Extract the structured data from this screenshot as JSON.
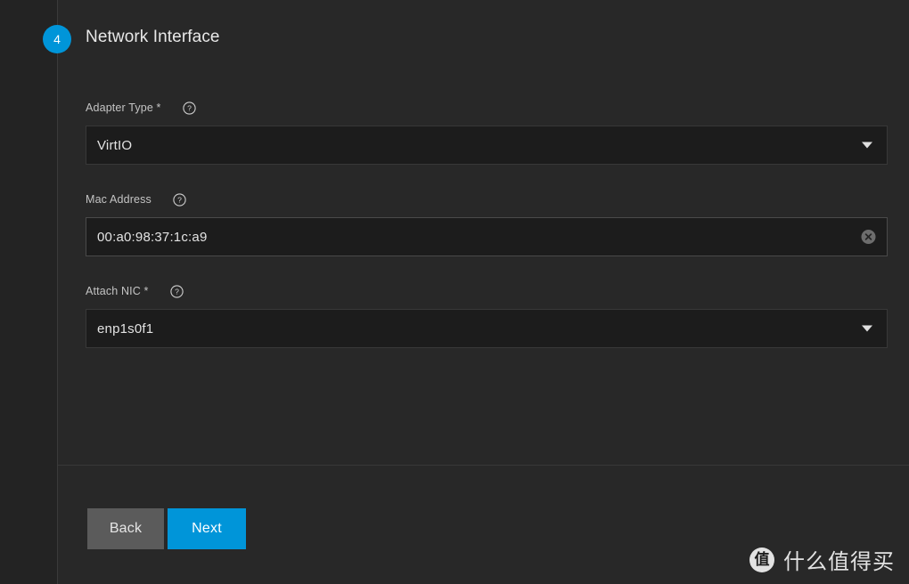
{
  "step": {
    "number": "4",
    "title": "Network Interface",
    "accent_color": "#0095d9"
  },
  "form": {
    "fields": [
      {
        "label": "Adapter Type *",
        "value": "VirtIO",
        "control": "select",
        "help_icon": "help-circle-icon",
        "caret_icon": "chevron-down-icon"
      },
      {
        "label": "Mac Address",
        "value": "00:a0:98:37:1c:a9",
        "control": "text",
        "help_icon": "help-circle-icon",
        "clear_icon": "clear-circle-icon"
      },
      {
        "label": "Attach NIC *",
        "value": "enp1s0f1",
        "control": "select",
        "help_icon": "help-circle-icon",
        "caret_icon": "chevron-down-icon"
      }
    ]
  },
  "footer": {
    "back_label": "Back",
    "next_label": "Next",
    "back_color": "#5b5b5b",
    "next_color": "#0095d9"
  },
  "watermark": {
    "logo_glyph": "值",
    "text": "什么值得买"
  }
}
